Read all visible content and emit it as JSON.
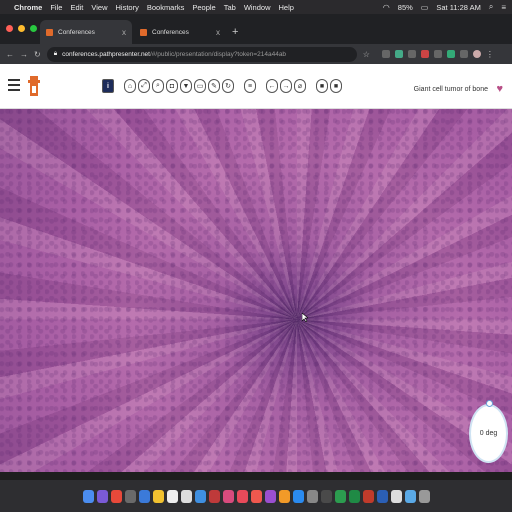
{
  "menubar": {
    "app": "Chrome",
    "items": [
      "File",
      "Edit",
      "View",
      "History",
      "Bookmarks",
      "People",
      "Tab",
      "Window",
      "Help"
    ],
    "battery": "85%",
    "clock": "Sat 11:28 AM"
  },
  "tabs": [
    {
      "label": "Conferences",
      "close": "x"
    },
    {
      "label": "Conferences",
      "close": "x"
    }
  ],
  "newtab": "+",
  "address": {
    "domain": "conferences.pathpresenter.net",
    "path": "/#/public/presentation/display?token=214a44ab"
  },
  "toolbar": {
    "info_label": "i",
    "case_title": "Giant cell tumor of bone"
  },
  "rotation": {
    "label": "0 deg"
  },
  "colors": {
    "toolbar_accent": "#1d2c5a",
    "logo": "#e06a2b",
    "tissue_pink": "#b56aa8",
    "tissue_purple": "#3d1f55"
  }
}
